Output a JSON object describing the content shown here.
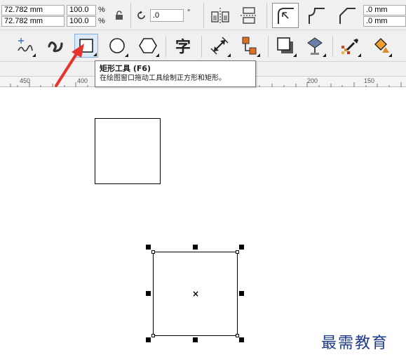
{
  "property_bar": {
    "width_value": "72.782 mm",
    "height_value": "72.782 mm",
    "scale_x": "100.0",
    "scale_y": "100.0",
    "percent_symbol": "%",
    "rotation_value": ".0",
    "degree_symbol": "°",
    "corner_radius_1": ".0 mm",
    "corner_radius_2": ".0 mm"
  },
  "toolbox": {
    "active_tool": "rectangle-tool",
    "tools": [
      "pick-tool",
      "freehand-tool",
      "artistic-media-tool",
      "rectangle-tool",
      "ellipse-tool",
      "polygon-tool",
      "text-tool",
      "parallel-dimension-tool",
      "connector-tool",
      "drop-shadow-tool",
      "transparency-tool",
      "color-eyedropper-tool",
      "interactive-fill-tool"
    ],
    "text_tool_glyph": "字"
  },
  "ruler": {
    "labels": [
      "450",
      "400",
      "200",
      "150"
    ]
  },
  "tooltip": {
    "title": "矩形工具 (F6)",
    "description": "在绘图窗口拖动工具绘制正方形和矩形。"
  },
  "watermark": {
    "text": "最需教育"
  },
  "colors": {
    "toolbar_bg": "#f0f0f0",
    "active_tool_bg": "#dbe9f8",
    "annotation_arrow": "#e8332a",
    "watermark": "#1e3a8a"
  }
}
